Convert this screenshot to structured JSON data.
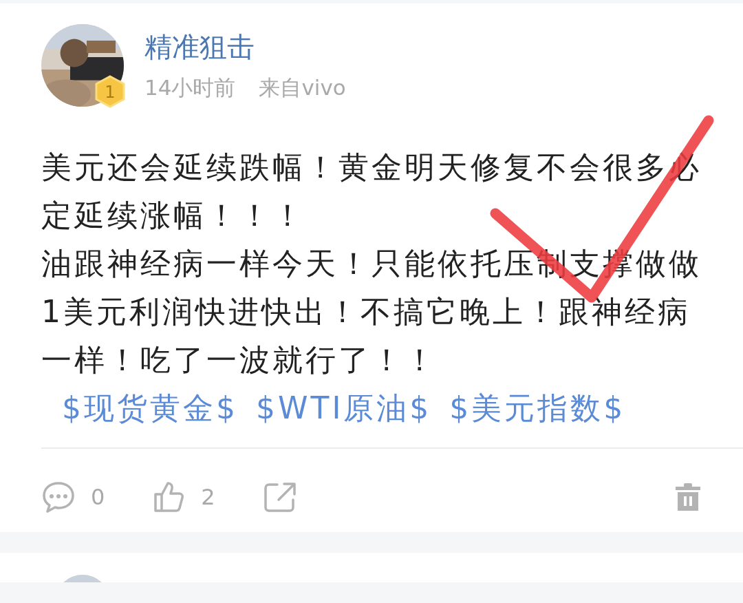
{
  "post": {
    "author": {
      "name": "精准狙击",
      "badge": "1"
    },
    "time": "14小时前",
    "source": "来自vivo",
    "paragraphs": [
      [
        {
          "kind": "text",
          "text": "美元还会延续跌幅！黄金明天修复不会很多必定延续涨幅！！！"
        }
      ],
      [
        {
          "kind": "text",
          "text": "油跟神经病一样今天！只能依托压制支撑做做1美元利润快进快出！不搞它晚上！跟神经病一样！吃了一波就行了！！"
        },
        {
          "kind": "tag",
          "text": "$现货黄金$"
        },
        {
          "kind": "tag",
          "text": "$WTI原油$"
        },
        {
          "kind": "tag",
          "text": "$美元指数$"
        }
      ]
    ],
    "annotation": {
      "kind": "checkmark"
    },
    "actions": [
      {
        "kind": "comment",
        "count": "0"
      },
      {
        "kind": "like",
        "count": "2"
      },
      {
        "kind": "share"
      },
      {
        "kind": "delete"
      }
    ]
  }
}
